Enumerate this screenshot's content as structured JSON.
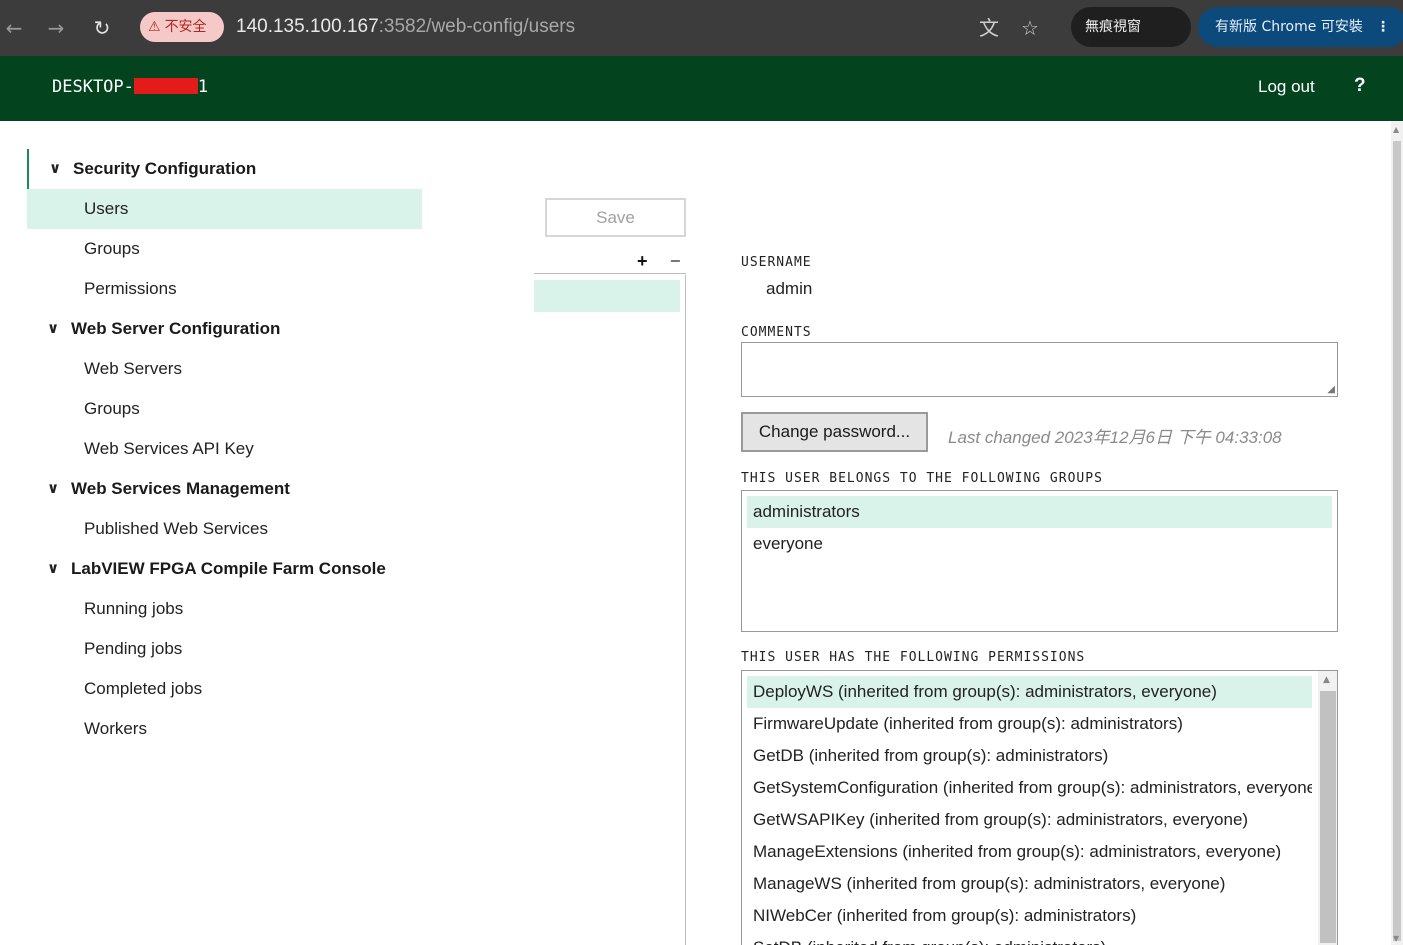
{
  "browser": {
    "back_icon": "←",
    "forward_icon": "→",
    "reload_icon": "↻",
    "security_warning_icon": "⚠",
    "security_label": "不安全",
    "url_host": "140.135.100.167",
    "url_rest": ":3582/web-config/users",
    "translate_icon": "文",
    "star_icon": "☆",
    "incognito_label": "無痕視窗",
    "update_label": "有新版 Chrome 可安裝",
    "menu_icon": "⋮"
  },
  "header": {
    "host_prefix": "DESKTOP-",
    "host_suffix": "1",
    "logout_label": "Log out",
    "help_label": "?"
  },
  "sidebar": {
    "sections": [
      {
        "label": "Security Configuration",
        "items": [
          "Users",
          "Groups",
          "Permissions"
        ]
      },
      {
        "label": "Web Server Configuration",
        "items": [
          "Web Servers",
          "Groups",
          "Web Services API Key"
        ]
      },
      {
        "label": "Web Services Management",
        "items": [
          "Published Web Services"
        ]
      },
      {
        "label": "LabVIEW FPGA Compile Farm Console",
        "items": [
          "Running jobs",
          "Pending jobs",
          "Completed jobs",
          "Workers"
        ]
      }
    ],
    "chevron_icon": "∨"
  },
  "toolbar": {
    "save_label": "Save",
    "add_label": "+",
    "remove_label": "−"
  },
  "user": {
    "username_label": "USERNAME",
    "username": "admin",
    "comments_label": "COMMENTS",
    "comments_value": "",
    "change_password_label": "Change password...",
    "last_changed": "Last changed 2023年12月6日 下午 04:33:08",
    "groups_label": "THIS USER BELONGS TO THE FOLLOWING GROUPS",
    "groups": [
      "administrators",
      "everyone"
    ],
    "permissions_label": "THIS USER HAS THE FOLLOWING PERMISSIONS",
    "permissions": [
      "DeployWS (inherited from group(s): administrators, everyone)",
      "FirmwareUpdate (inherited from group(s): administrators)",
      "GetDB (inherited from group(s): administrators)",
      "GetSystemConfiguration (inherited from group(s): administrators, everyone)",
      "GetWSAPIKey (inherited from group(s): administrators, everyone)",
      "ManageExtensions (inherited from group(s): administrators, everyone)",
      "ManageWS (inherited from group(s): administrators, everyone)",
      "NIWebCer (inherited from group(s): administrators)",
      "SetDB (inherited from group(s): administrators)"
    ]
  },
  "colors": {
    "header_bg": "#03441f",
    "selection_bg": "#d9f2ea",
    "active_accent": "#1a8a5a"
  }
}
